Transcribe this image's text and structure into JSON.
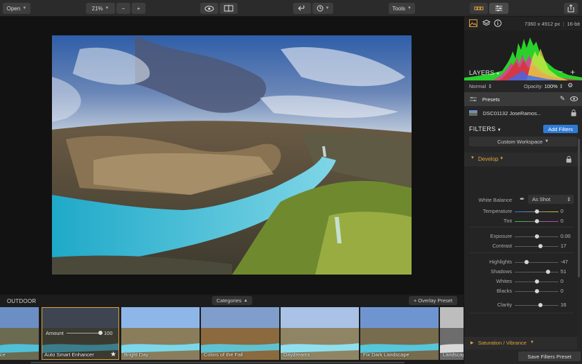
{
  "toolbar": {
    "open_label": "Open",
    "zoom_value": "21%",
    "zoom_out": "−",
    "zoom_in": "+",
    "tools_label": "Tools"
  },
  "filmstrip": {
    "category_title": "OUTDOOR",
    "categories_label": "Categories",
    "overlay_label": "+ Overlay Preset",
    "amount_label": "Amount",
    "amount_value": "100",
    "presets": [
      {
        "name": "ce"
      },
      {
        "name": "Auto Smart Enhancer"
      },
      {
        "name": "Bright Day"
      },
      {
        "name": "Colors of the Fall"
      },
      {
        "name": "Daydreams"
      },
      {
        "name": "Fix Dark Landscape"
      },
      {
        "name": "Landscap"
      }
    ]
  },
  "panel": {
    "image_info": "7360 x 4912 px",
    "bit_depth": "16-bit",
    "layers_title": "LAYERS",
    "blend_mode": "Normal",
    "opacity_label": "Opacity:",
    "opacity_value": "100%",
    "layers": [
      {
        "name": "Presets"
      },
      {
        "name": "DSC01132 JoseRamos..."
      }
    ],
    "filters_title": "FILTERS",
    "add_filters": "Add Filters",
    "workspace": "Custom Workspace",
    "develop_title": "Develop",
    "white_balance_label": "White Balance",
    "white_balance_value": "As Shot",
    "sliders": [
      {
        "label": "Temperature",
        "value": "0",
        "level": 0.5
      },
      {
        "label": "Tint",
        "value": "0",
        "level": 0.5
      },
      {
        "label": "Exposure",
        "value": "0.00",
        "level": 0.5
      },
      {
        "label": "Contrast",
        "value": "17",
        "level": 0.585
      },
      {
        "label": "Highlights",
        "value": "-47",
        "level": 0.265
      },
      {
        "label": "Shadows",
        "value": "51",
        "level": 0.755
      },
      {
        "label": "Whites",
        "value": "0",
        "level": 0.5
      },
      {
        "label": "Blacks",
        "value": "0",
        "level": 0.5
      },
      {
        "label": "Clarity",
        "value": "16",
        "level": 0.58
      }
    ],
    "saturation_title": "Saturation / Vibrance",
    "save_preset": "Save Filters Preset"
  }
}
